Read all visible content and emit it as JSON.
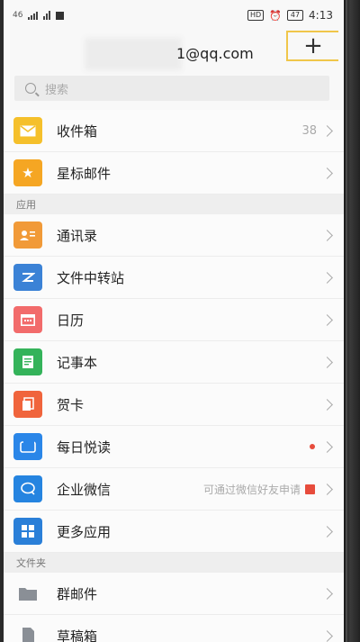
{
  "status_bar": {
    "signal": "46",
    "hd": "HD",
    "battery": "47",
    "time": "4:13"
  },
  "header": {
    "account": "1@qq.com",
    "add_label": "+"
  },
  "search": {
    "placeholder": "搜索"
  },
  "mail_items": [
    {
      "label": "收件箱",
      "count": "38",
      "icon": "inbox-icon",
      "color": "#f5c02b"
    },
    {
      "label": "星标邮件",
      "icon": "star-icon",
      "color": "#f5a623"
    }
  ],
  "sections": {
    "apps": "应用",
    "folders": "文件夹"
  },
  "app_items": [
    {
      "label": "通讯录",
      "icon": "contacts-icon",
      "color": "#f19a38"
    },
    {
      "label": "文件中转站",
      "icon": "file-transfer-icon",
      "color": "#3b82d6"
    },
    {
      "label": "日历",
      "icon": "calendar-icon",
      "color": "#f26b6b"
    },
    {
      "label": "记事本",
      "icon": "notepad-icon",
      "color": "#34b35a"
    },
    {
      "label": "贺卡",
      "icon": "greeting-card-icon",
      "color": "#f0643c"
    },
    {
      "label": "每日悦读",
      "icon": "daily-read-icon",
      "color": "#2a86e8"
    },
    {
      "label": "企业微信",
      "hint": "可通过微信好友申请",
      "icon": "wework-icon",
      "color": "#2584e0"
    },
    {
      "label": "更多应用",
      "icon": "more-apps-icon",
      "color": "#2a7fd8"
    }
  ],
  "folder_items": [
    {
      "label": "群邮件",
      "icon": "group-mail-icon"
    },
    {
      "label": "草稿箱",
      "icon": "drafts-icon"
    }
  ]
}
